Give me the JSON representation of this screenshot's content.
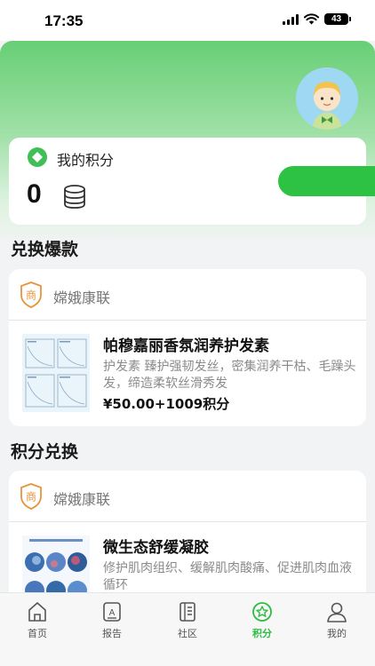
{
  "status_bar": {
    "time": "17:35",
    "battery": "43"
  },
  "points": {
    "title": "我的积分",
    "value": "0"
  },
  "sections": [
    {
      "title": "兑换爆款",
      "shop": "嫦娥康联",
      "product": {
        "name": "帕穆嘉丽香氛润养护发素",
        "desc": "护发素 臻护强韧发丝，密集润养干枯、毛躁头发，缔造柔软丝滑秀发",
        "price": "¥50.00+1009积分"
      }
    },
    {
      "title": "积分兑换",
      "shop": "嫦娥康联",
      "product": {
        "name": "微生态舒缓凝胶",
        "desc": "修护肌肉组织、缓解肌肉酸痛、促进肌肉血液循环"
      }
    }
  ],
  "tabs": [
    {
      "label": "首页",
      "icon": "home-icon"
    },
    {
      "label": "报告",
      "icon": "report-icon"
    },
    {
      "label": "社区",
      "icon": "community-icon"
    },
    {
      "label": "积分",
      "icon": "points-star-icon",
      "active": true
    },
    {
      "label": "我的",
      "icon": "profile-icon"
    }
  ],
  "colors": {
    "accent": "#2dc243",
    "header_green": "#67cf75",
    "badge_orange": "#e8933c"
  }
}
